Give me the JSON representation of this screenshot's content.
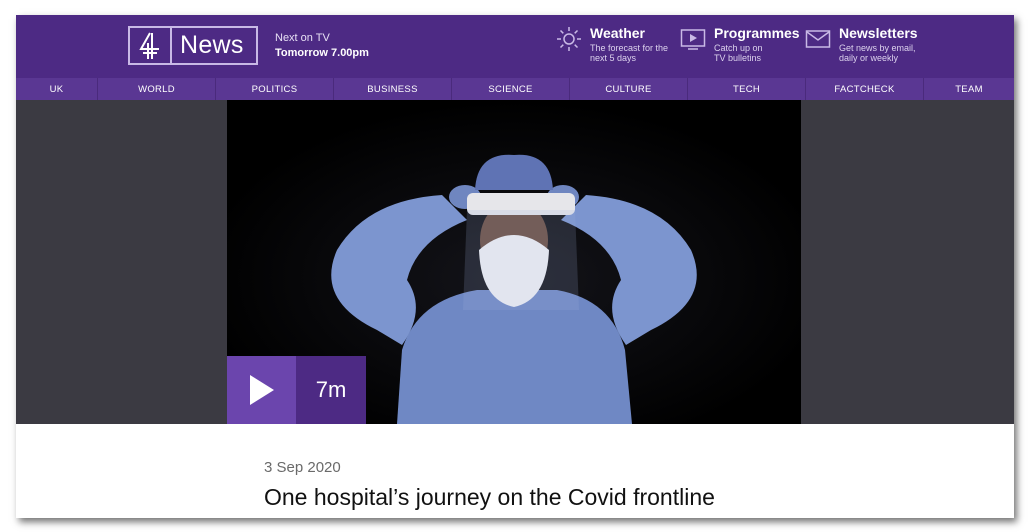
{
  "brand": {
    "logo_text": "News",
    "logo_mark": "4-logo-icon"
  },
  "next_on_tv": {
    "label": "Next on TV",
    "time": "Tomorrow 7.00pm"
  },
  "header_links": {
    "weather": {
      "title": "Weather",
      "sub1": "The forecast for the",
      "sub2": "next 5 days",
      "icon": "sun-icon"
    },
    "programmes": {
      "title": "Programmes",
      "sub1": "Catch up on",
      "sub2": "TV bulletins",
      "icon": "play-screen-icon"
    },
    "newsletters": {
      "title": "Newsletters",
      "sub1": "Get news by email,",
      "sub2": "daily or weekly",
      "icon": "envelope-icon"
    }
  },
  "nav": [
    "UK",
    "WORLD",
    "POLITICS",
    "BUSINESS",
    "SCIENCE",
    "CULTURE",
    "TECH",
    "FACTCHECK",
    "TEAM"
  ],
  "video": {
    "duration": "7m",
    "play_icon": "play-icon"
  },
  "article": {
    "date": "3 Sep 2020",
    "headline": "One hospital’s journey on the Covid frontline"
  },
  "colors": {
    "header": "#4d2a84",
    "nav": "#5a3793",
    "play": "#6b45ad",
    "video_side": "#3b3a42"
  }
}
